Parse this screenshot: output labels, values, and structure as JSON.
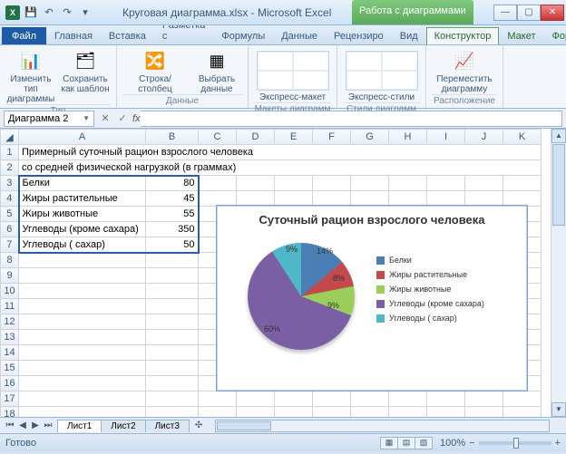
{
  "window": {
    "title_doc": "Круговая диаграмма.xlsx - Microsoft Excel",
    "tools_title": "Работа с диаграммами"
  },
  "tabs": {
    "file": "Файл",
    "list": [
      "Главная",
      "Вставка",
      "Разметка с",
      "Формулы",
      "Данные",
      "Рецензиро",
      "Вид"
    ],
    "chart": [
      "Конструктор",
      "Макет",
      "Формат"
    ]
  },
  "ribbon": {
    "g1": {
      "b1": "Изменить тип\nдиаграммы",
      "b2": "Сохранить\nкак шаблон",
      "label": "Тип"
    },
    "g2": {
      "b1": "Строка/столбец",
      "b2": "Выбрать\nданные",
      "label": "Данные"
    },
    "g3": {
      "b1": "Экспресс-макет",
      "label": "Макеты диаграмм"
    },
    "g4": {
      "b1": "Экспресс-стили",
      "label": "Стили диаграмм"
    },
    "g5": {
      "b1": "Переместить\nдиаграмму",
      "label": "Расположение"
    }
  },
  "namebox": "Диаграмма 2",
  "fx": "fx",
  "cells": {
    "r1": "Примерный суточный рацион взрослого человека",
    "r2": "со средней физической нагрузкой (в граммах)",
    "rows": [
      {
        "a": "Белки",
        "b": "80"
      },
      {
        "a": "Жиры растительные",
        "b": "45"
      },
      {
        "a": "Жиры животные",
        "b": "55"
      },
      {
        "a": "Углеводы (кроме сахара)",
        "b": "350"
      },
      {
        "a": "Углеводы ( сахар)",
        "b": "50"
      }
    ]
  },
  "chart_data": {
    "type": "pie",
    "title": "Суточный рацион взрослого человека",
    "series": [
      {
        "name": "Белки",
        "value": 80,
        "pct": "14%",
        "color": "#4a7fb5"
      },
      {
        "name": "Жиры растительные",
        "value": 45,
        "pct": "8%",
        "color": "#c24a4a"
      },
      {
        "name": "Жиры животные",
        "value": 55,
        "pct": "9%",
        "color": "#9bcd5b"
      },
      {
        "name": "Углеводы (кроме сахара)",
        "value": 350,
        "pct": "60%",
        "color": "#7a5fa5"
      },
      {
        "name": "Углеводы ( сахар)",
        "value": 50,
        "pct": "9%",
        "color": "#4fb7c6"
      }
    ]
  },
  "cols": [
    "A",
    "B",
    "C",
    "D",
    "E",
    "F",
    "G",
    "H",
    "I",
    "J",
    "K"
  ],
  "sheets": [
    "Лист1",
    "Лист2",
    "Лист3"
  ],
  "status": "Готово",
  "zoom": "100%"
}
